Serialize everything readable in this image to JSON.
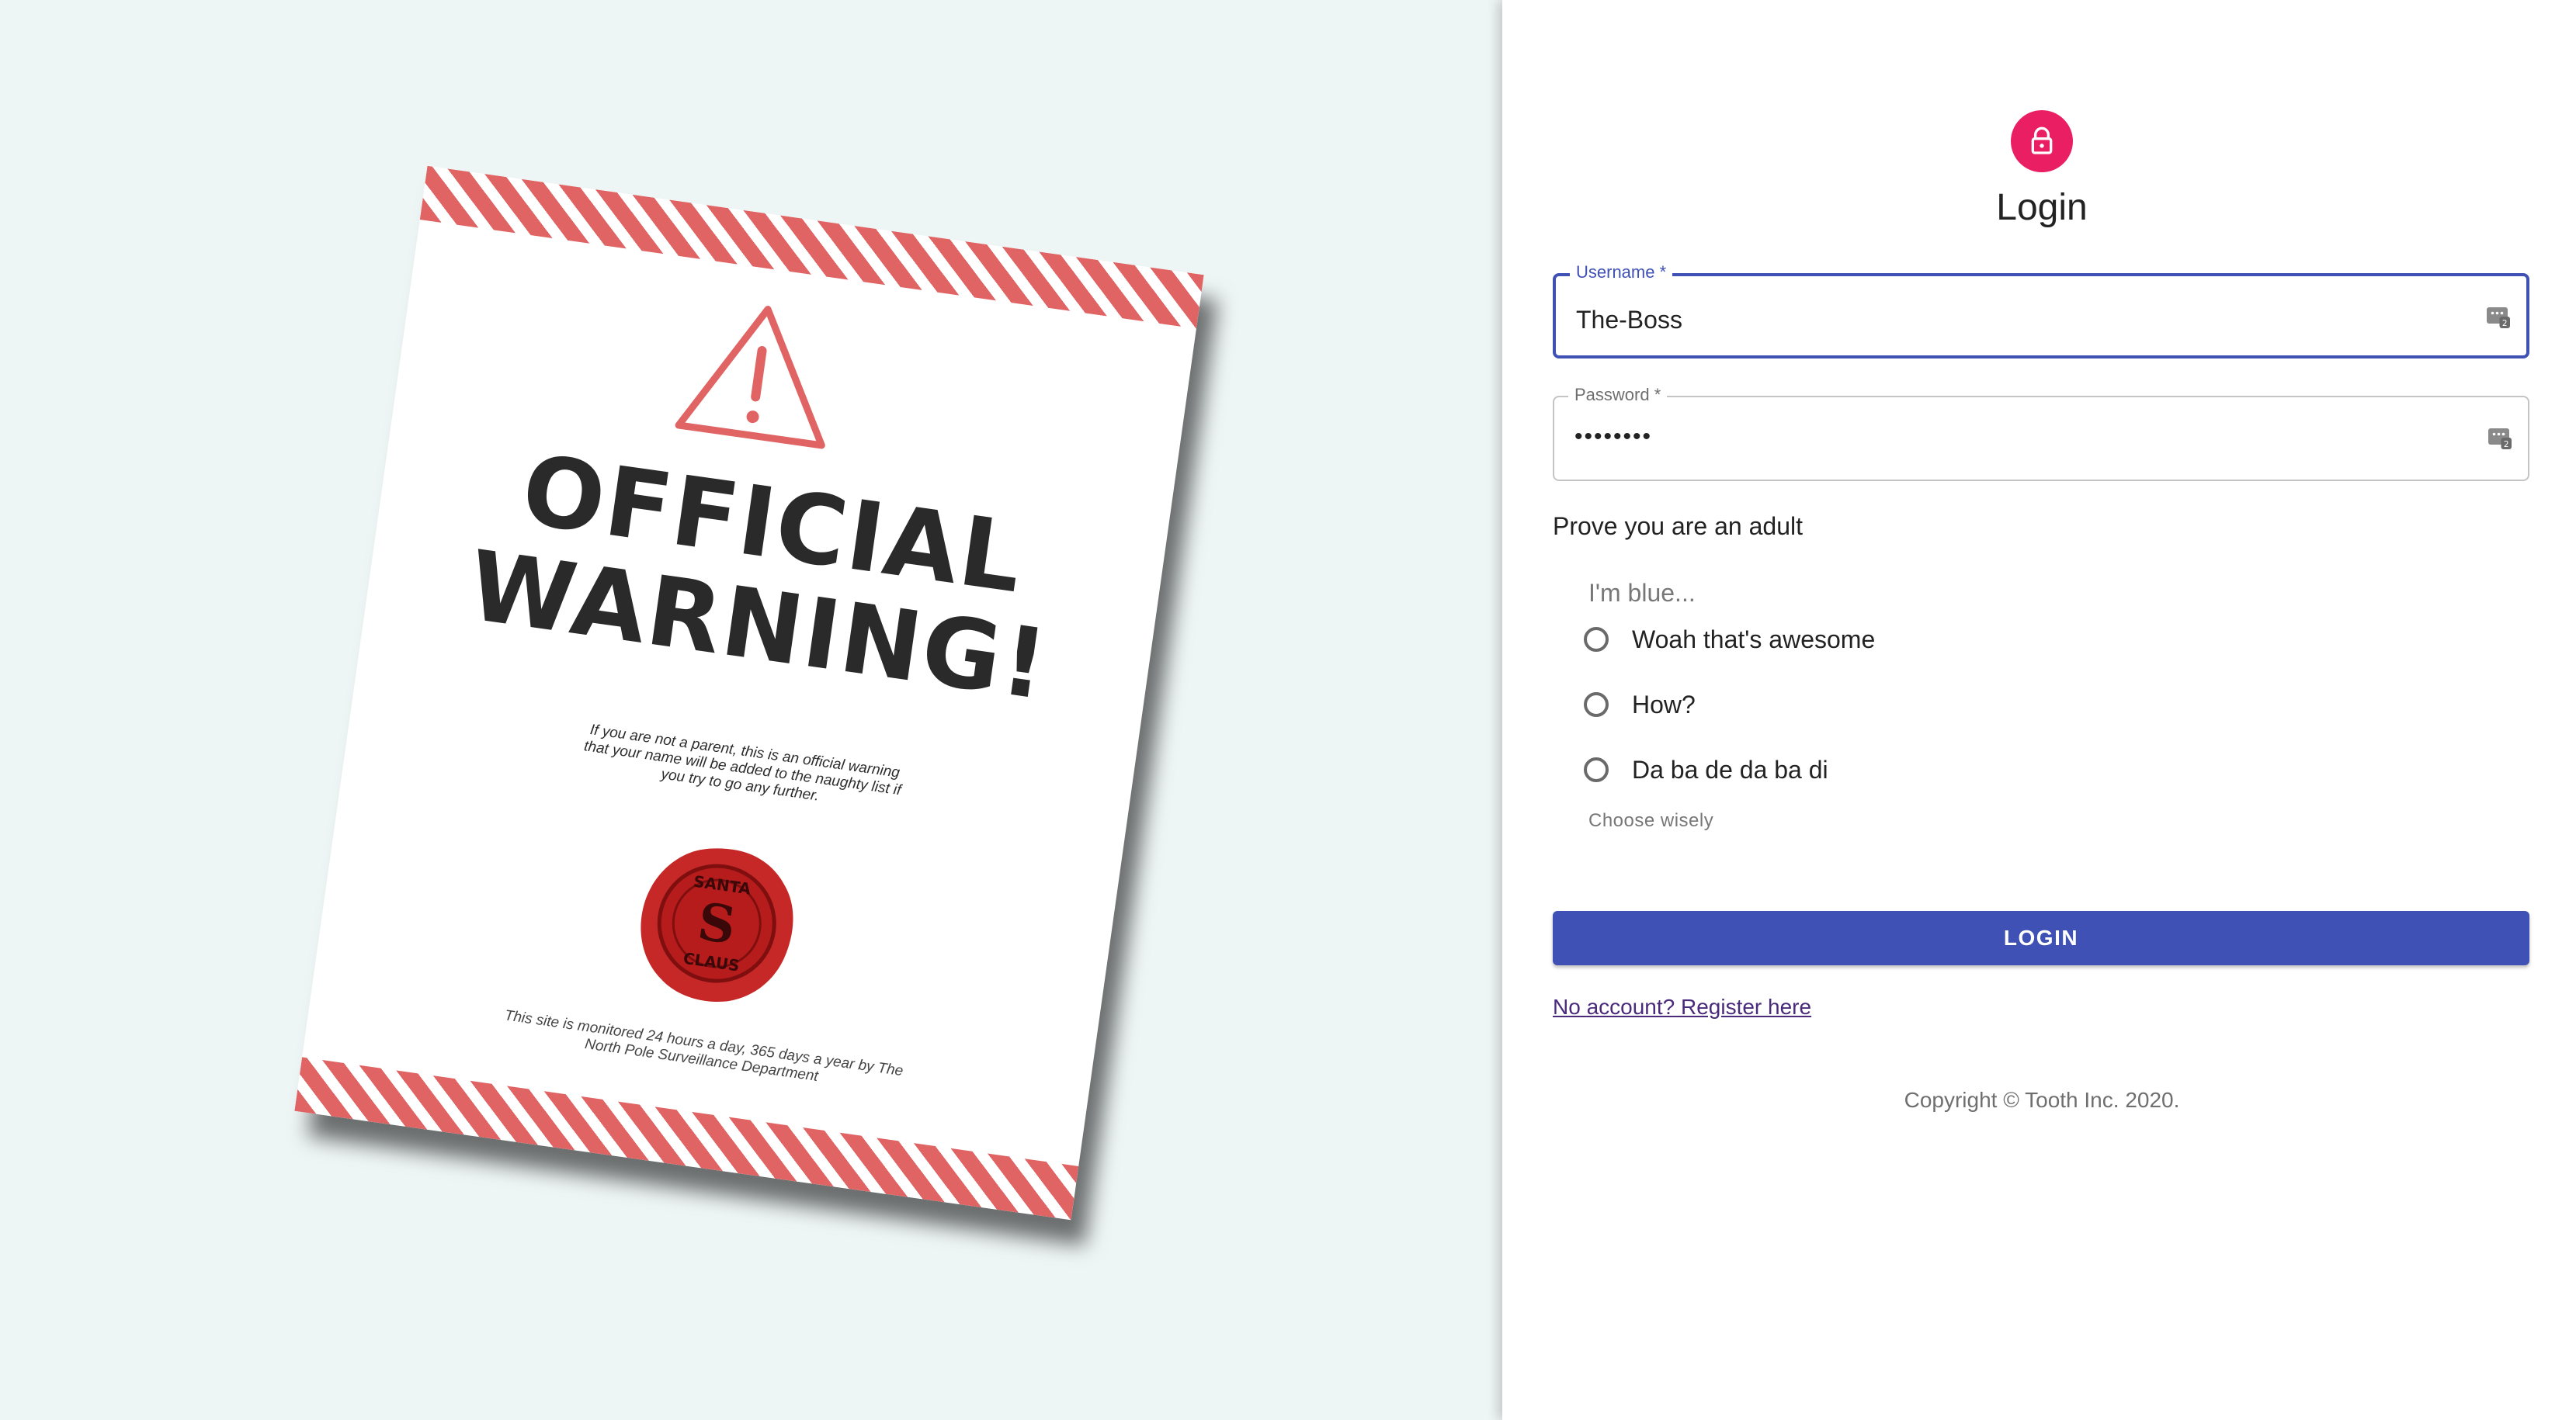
{
  "poster": {
    "title_line1": "OFFICIAL",
    "title_line2": "WARNING!",
    "body": "If you are not a parent, this is an official warning that your name will be added to the naughty list if you try to go any further.",
    "footer": "This site is monitored 24 hours a day, 365 days a year by The North Pole Surveillance Department",
    "seal_text_top": "SANTA",
    "seal_text_bottom": "CLAUS",
    "seal_monogram": "S",
    "stripe_color": "#e06464",
    "seal_color": "#c62828"
  },
  "form": {
    "title": "Login",
    "avatar_icon": "lock-icon",
    "avatar_color": "#e91e63",
    "username": {
      "label": "Username *",
      "value": "The-Boss"
    },
    "password": {
      "label": "Password *",
      "value": "••••••••"
    },
    "prove_label": "Prove you are an adult",
    "quiz": {
      "question": "I'm blue...",
      "options": [
        "Woah that's awesome",
        "How?",
        "Da ba de da ba di"
      ],
      "helper": "Choose wisely"
    },
    "login_button": "LOGIN",
    "register_link": "No account? Register here",
    "copyright": "Copyright © Tooth Inc. 2020.",
    "accent_color": "#3f51b5"
  }
}
